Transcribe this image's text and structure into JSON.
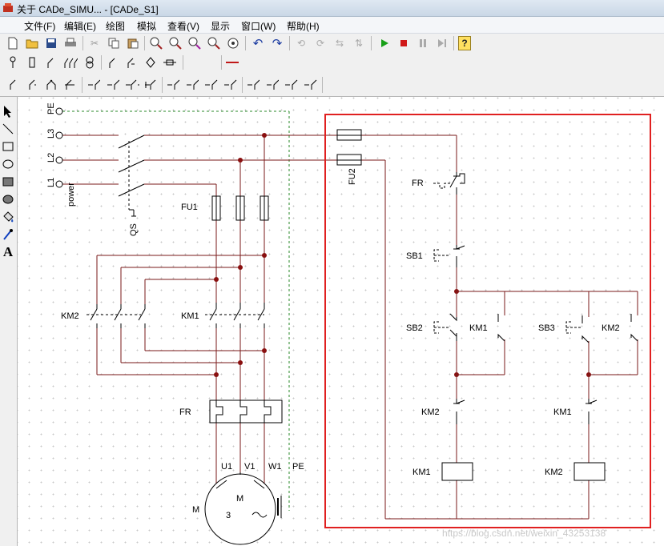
{
  "window": {
    "title": "关于 CADe_SIMU... - [CADe_S1]"
  },
  "menu": [
    "文件(F)",
    "编辑(E)",
    "绘图",
    "模拟",
    "查看(V)",
    "显示",
    "窗口(W)",
    "帮助(H)"
  ],
  "toolbar": {
    "help_label": "?"
  },
  "schematic": {
    "supply": {
      "pe": "PE",
      "l3": "L3",
      "l2": "L2",
      "l1": "L1",
      "power": "power",
      "qs": "QS"
    },
    "fu1": "FU1",
    "fu2": "FU2",
    "km2_main": "KM2",
    "km1_main": "KM1",
    "fr_main": "FR",
    "motor": {
      "u1": "U1",
      "v1": "V1",
      "w1": "W1",
      "pe": "PE",
      "m_outer": "M",
      "m_inner": "M",
      "phases": "3",
      "tilde": "~"
    },
    "control": {
      "fr": "FR",
      "sb1": "SB1",
      "sb2": "SB2",
      "km1_hold": "KM1",
      "sb3": "SB3",
      "km2_hold": "KM2",
      "km2_interlock": "KM2",
      "km1_interlock": "KM1",
      "km1_coil": "KM1",
      "km2_coil": "KM2"
    },
    "watermark": "https://blog.csdn.net/weixin_43253138",
    "colors": {
      "wire": "#7a1a1a",
      "highlight": "#e02020",
      "pe": "#2a8a2a"
    }
  }
}
